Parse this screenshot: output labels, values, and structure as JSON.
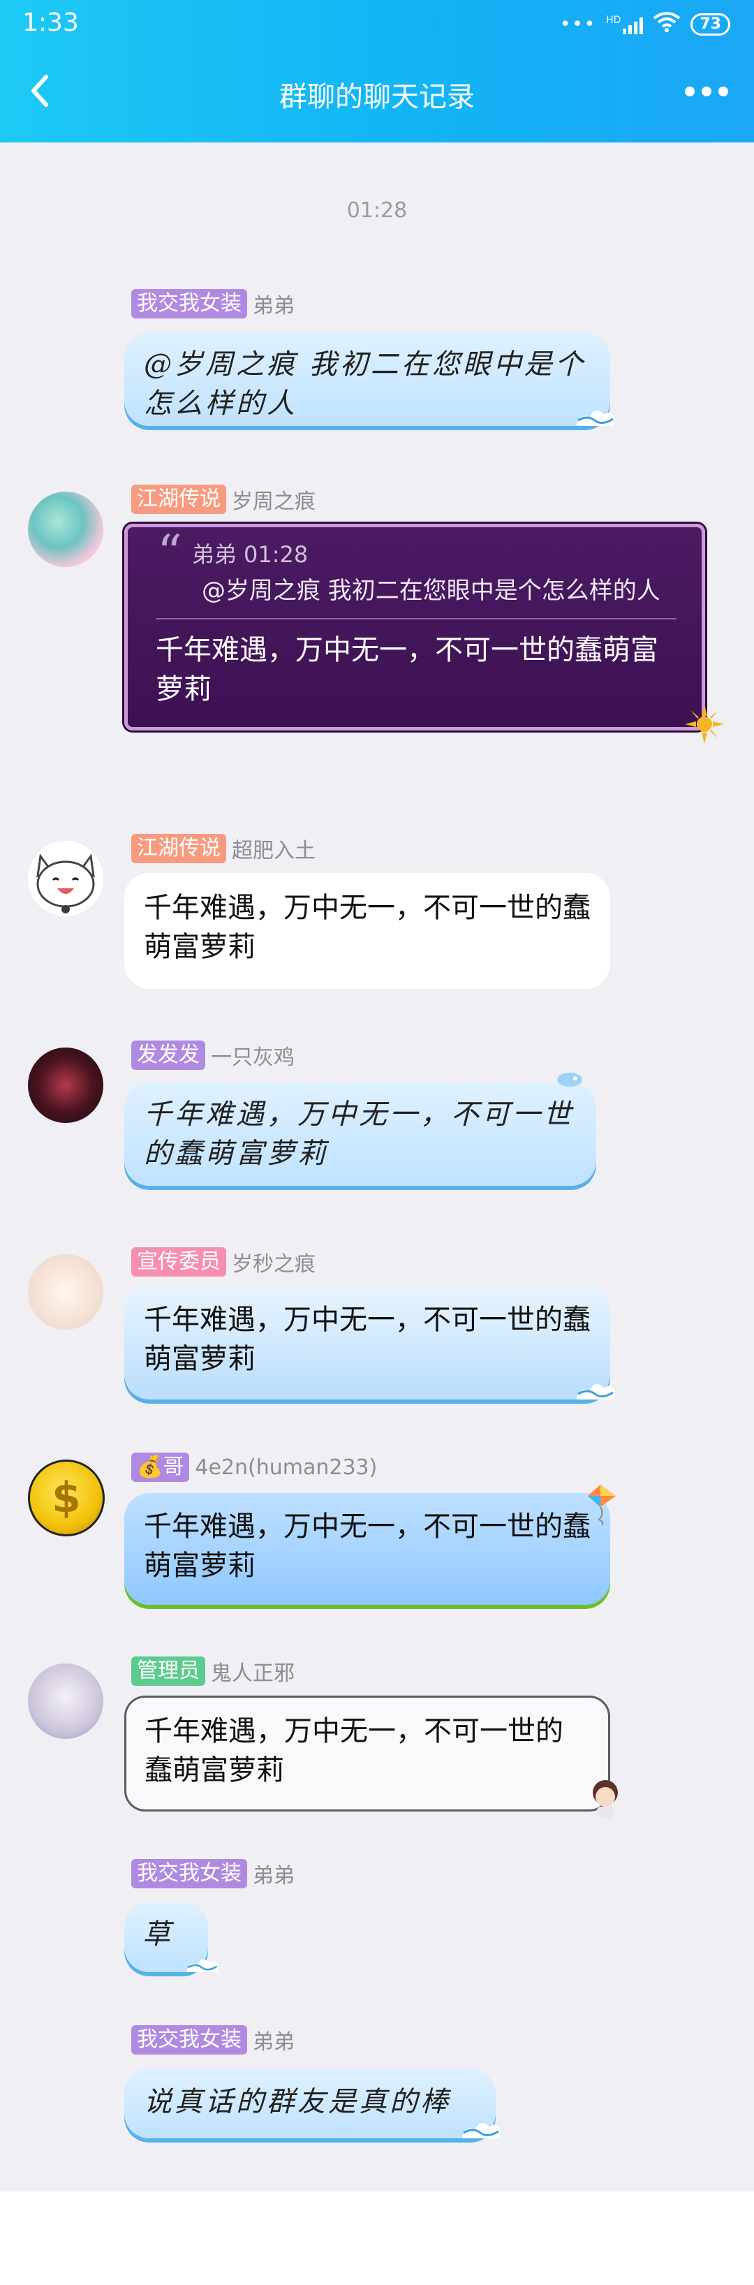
{
  "status": {
    "time": "1:33",
    "hd": "HD",
    "battery": "73"
  },
  "header": {
    "title": "群聊的聊天记录"
  },
  "timestamp": "01:28",
  "messages": [
    {
      "badge": "我交我女装",
      "nick": "弟弟",
      "text": "@岁周之痕 我初二在您眼中是个怎么样的人"
    },
    {
      "badge": "江湖传说",
      "nick": "岁周之痕",
      "quote_meta": "弟弟 01:28",
      "quote_text": "@岁周之痕 我初二在您眼中是个怎么样的人",
      "text": "千年难遇，万中无一，不可一世的蠢萌富萝莉"
    },
    {
      "badge": "江湖传说",
      "nick": "超肥入土",
      "text": "千年难遇，万中无一，不可一世的蠢萌富萝莉"
    },
    {
      "badge": "发发发",
      "nick": "一只灰鸡",
      "text": "千年难遇，万中无一，不可一世的蠢萌富萝莉"
    },
    {
      "badge": "宣传委员",
      "nick": "岁秒之痕",
      "text": "千年难遇，万中无一，不可一世的蠢萌富萝莉"
    },
    {
      "badge": "💰哥",
      "nick": "4e2n(human233)",
      "text": "千年难遇，万中无一，不可一世的蠢萌富萝莉"
    },
    {
      "badge": "管理员",
      "nick": "鬼人正邪",
      "text": "千年难遇，万中无一，不可一世的蠢萌富萝莉"
    },
    {
      "badge": "我交我女装",
      "nick": "弟弟",
      "text": "草"
    },
    {
      "badge": "我交我女装",
      "nick": "弟弟",
      "text": "说真话的群友是真的棒"
    }
  ],
  "colors": {
    "header_start": "#1ec9f4",
    "header_end": "#1aa7f5",
    "badge_purple": "#b08ae0",
    "badge_orange": "#f79a7f",
    "badge_pink": "#f58eb0",
    "badge_green": "#5ccb8e",
    "chat_bg": "#efeff4"
  }
}
